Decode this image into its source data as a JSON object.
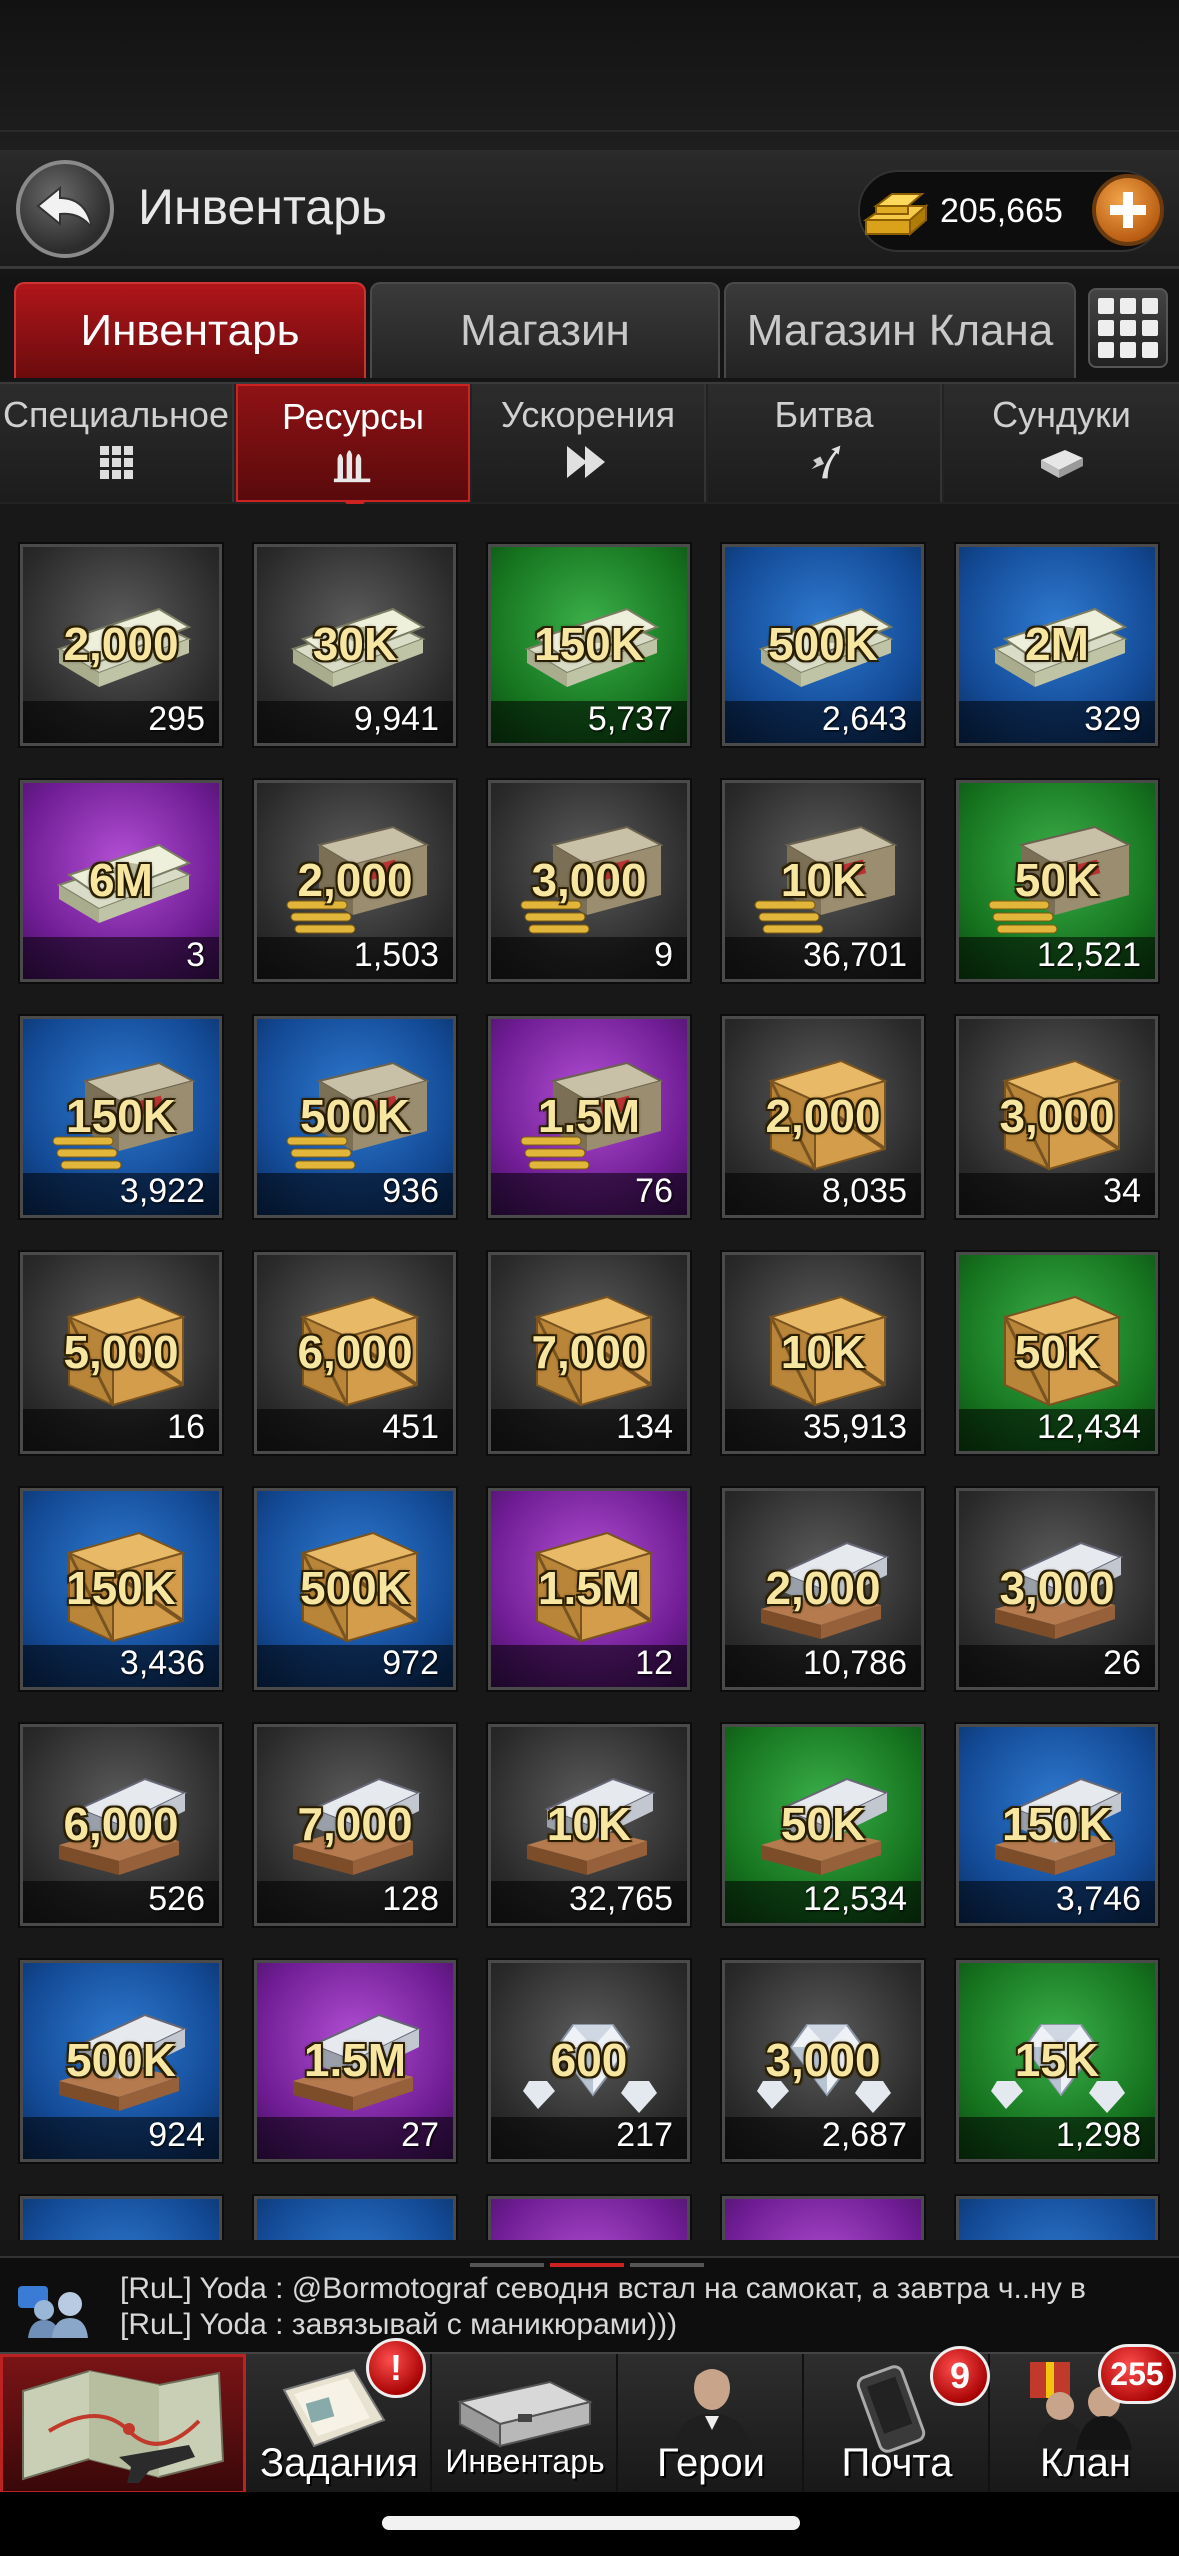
{
  "header": {
    "title": "Инвентарь",
    "gold": "205,665"
  },
  "main_tabs": [
    {
      "label": "Инвентарь",
      "active": true
    },
    {
      "label": "Магазин",
      "active": false
    },
    {
      "label": "Магазин Клана",
      "active": false
    }
  ],
  "sub_tabs": [
    {
      "label": "Специальное",
      "icon": "grid-icon"
    },
    {
      "label": "Ресурсы",
      "icon": "ammo-icon",
      "active": true
    },
    {
      "label": "Ускорения",
      "icon": "fast-forward-icon"
    },
    {
      "label": "Битва",
      "icon": "battle-icon"
    },
    {
      "label": "Сундуки",
      "icon": "chest-icon"
    }
  ],
  "items": [
    {
      "amount": "2,000",
      "count": "295",
      "type": "cash",
      "bg": "gray"
    },
    {
      "amount": "30K",
      "count": "9,941",
      "type": "cash",
      "bg": "gray"
    },
    {
      "amount": "150K",
      "count": "5,737",
      "type": "cash",
      "bg": "green"
    },
    {
      "amount": "500K",
      "count": "2,643",
      "type": "cash",
      "bg": "blue"
    },
    {
      "amount": "2M",
      "count": "329",
      "type": "cash",
      "bg": "blue"
    },
    {
      "amount": "6M",
      "count": "3",
      "type": "cash",
      "bg": "purple"
    },
    {
      "amount": "2,000",
      "count": "1,503",
      "type": "ammo",
      "bg": "gray"
    },
    {
      "amount": "3,000",
      "count": "9",
      "type": "ammo",
      "bg": "gray"
    },
    {
      "amount": "10K",
      "count": "36,701",
      "type": "ammo",
      "bg": "gray"
    },
    {
      "amount": "50K",
      "count": "12,521",
      "type": "ammo",
      "bg": "green"
    },
    {
      "amount": "150K",
      "count": "3,922",
      "type": "ammo",
      "bg": "blue"
    },
    {
      "amount": "500K",
      "count": "936",
      "type": "ammo",
      "bg": "blue"
    },
    {
      "amount": "1.5M",
      "count": "76",
      "type": "ammo",
      "bg": "purple"
    },
    {
      "amount": "2,000",
      "count": "8,035",
      "type": "crate",
      "bg": "gray"
    },
    {
      "amount": "3,000",
      "count": "34",
      "type": "crate",
      "bg": "gray"
    },
    {
      "amount": "5,000",
      "count": "16",
      "type": "crate",
      "bg": "gray"
    },
    {
      "amount": "6,000",
      "count": "451",
      "type": "crate",
      "bg": "gray"
    },
    {
      "amount": "7,000",
      "count": "134",
      "type": "crate",
      "bg": "gray"
    },
    {
      "amount": "10K",
      "count": "35,913",
      "type": "crate",
      "bg": "gray"
    },
    {
      "amount": "50K",
      "count": "12,434",
      "type": "crate",
      "bg": "green"
    },
    {
      "amount": "150K",
      "count": "3,436",
      "type": "crate",
      "bg": "blue"
    },
    {
      "amount": "500K",
      "count": "972",
      "type": "crate",
      "bg": "blue"
    },
    {
      "amount": "1.5M",
      "count": "12",
      "type": "crate",
      "bg": "purple"
    },
    {
      "amount": "2,000",
      "count": "10,786",
      "type": "metal",
      "bg": "gray"
    },
    {
      "amount": "3,000",
      "count": "26",
      "type": "metal",
      "bg": "gray"
    },
    {
      "amount": "6,000",
      "count": "526",
      "type": "metal",
      "bg": "gray"
    },
    {
      "amount": "7,000",
      "count": "128",
      "type": "metal",
      "bg": "gray"
    },
    {
      "amount": "10K",
      "count": "32,765",
      "type": "metal",
      "bg": "gray"
    },
    {
      "amount": "50K",
      "count": "12,534",
      "type": "metal",
      "bg": "green"
    },
    {
      "amount": "150K",
      "count": "3,746",
      "type": "metal",
      "bg": "blue"
    },
    {
      "amount": "500K",
      "count": "924",
      "type": "metal",
      "bg": "blue"
    },
    {
      "amount": "1.5M",
      "count": "27",
      "type": "metal",
      "bg": "purple"
    },
    {
      "amount": "600",
      "count": "217",
      "type": "diamond",
      "bg": "gray"
    },
    {
      "amount": "3,000",
      "count": "2,687",
      "type": "diamond",
      "bg": "gray"
    },
    {
      "amount": "15K",
      "count": "1,298",
      "type": "diamond",
      "bg": "green"
    }
  ],
  "partial_row_bgs": [
    "blue",
    "blue",
    "purple",
    "purple",
    "blue"
  ],
  "chat": {
    "lines": [
      "[RuL] Yoda : @Bormotograf севодня встал на самокат, а завтра ч..ну в",
      "[RuL] Yoda : завязывай с маникюрами)))"
    ]
  },
  "bottom_nav": [
    {
      "label": "",
      "icon": "map-icon"
    },
    {
      "label": "Задания",
      "icon": "tasks-icon",
      "badge": "!"
    },
    {
      "label": "Инвентарь",
      "icon": "briefcase-icon"
    },
    {
      "label": "Герои",
      "icon": "hero-icon"
    },
    {
      "label": "Почта",
      "icon": "mail-icon",
      "badge": "9"
    },
    {
      "label": "Клан",
      "icon": "clan-icon",
      "badge": "255"
    }
  ]
}
